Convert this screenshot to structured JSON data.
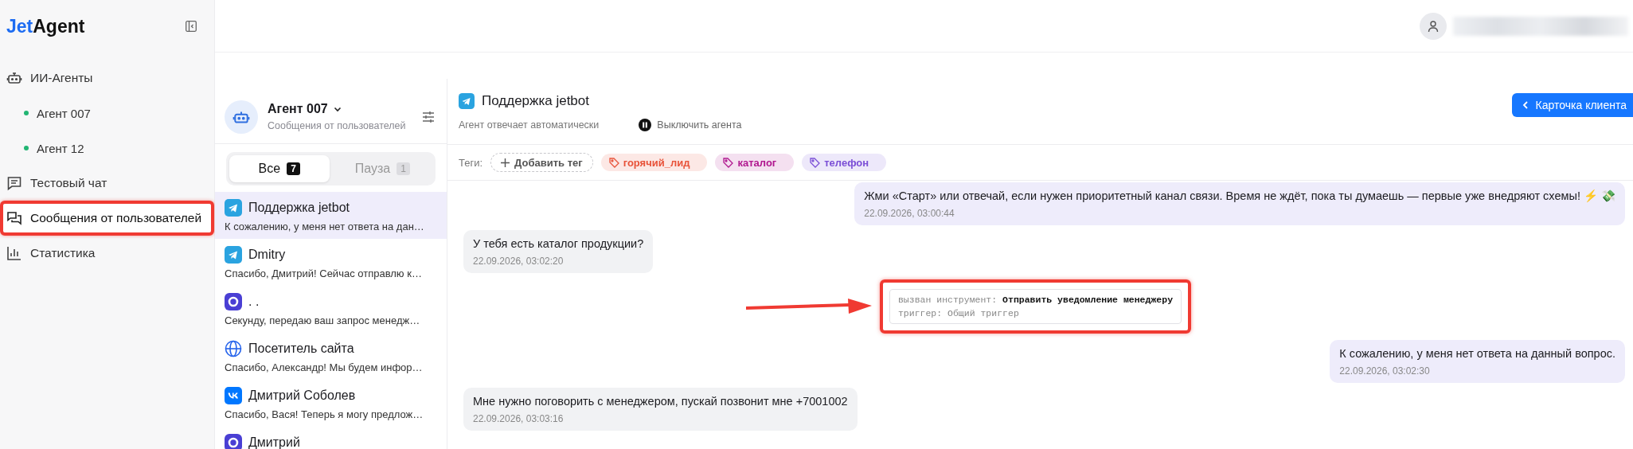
{
  "sidebar": {
    "logo": {
      "accent": "Jet",
      "rest": "Agent"
    },
    "items": [
      {
        "label": "ИИ-Агенты",
        "kind": "robot",
        "selected": false,
        "highlighted": false,
        "children": [
          {
            "label": "Агент 007",
            "color": "#22b573"
          },
          {
            "label": "Агент 12",
            "color": "#22b573"
          }
        ]
      },
      {
        "label": "Тестовый чат",
        "kind": "chat",
        "selected": false,
        "highlighted": false
      },
      {
        "label": "Сообщения от пользователей",
        "kind": "messages",
        "selected": true,
        "highlighted": true
      },
      {
        "label": "Статистика",
        "kind": "chart",
        "selected": false,
        "highlighted": false
      }
    ]
  },
  "conversation_list": {
    "agent": {
      "name": "Агент 007",
      "subtitle": "Сообщения от пользователей"
    },
    "tabs": [
      {
        "label": "Все",
        "count": "7",
        "selected": true
      },
      {
        "label": "Пауза",
        "count": "1",
        "selected": false
      }
    ],
    "items": [
      {
        "kind": "telegram",
        "name": "Поддержка jetbot",
        "preview": "К сожалению, у меня нет ответа на дан…",
        "selected": true
      },
      {
        "kind": "telegram",
        "name": "Dmitry",
        "preview": "Спасибо, Дмитрий! Сейчас отправлю к…",
        "selected": false
      },
      {
        "kind": "ring",
        "name": ". .",
        "preview": "Секунду, передаю ваш запрос менедж…",
        "selected": false
      },
      {
        "kind": "web",
        "name": "Посетитель сайта",
        "preview": "Спасибо, Александр! Мы будем инфор…",
        "selected": false
      },
      {
        "kind": "vk",
        "name": "Дмитрий Соболев",
        "preview": "Спасибо, Вася! Теперь я могу предлож…",
        "selected": false
      },
      {
        "kind": "ring",
        "name": "Дмитрий",
        "selected": false
      }
    ]
  },
  "chat": {
    "kind": "telegram",
    "title": "Поддержка jetbot",
    "status": "Агент отвечает автоматически",
    "pause_button": "Выключить агента",
    "client_card_button": "Карточка клиента",
    "tags_label": "Теги:",
    "add_tag_button": "Добавить тег",
    "tags": [
      {
        "label": "горячий_лид",
        "color": "#e8533a"
      },
      {
        "label": "каталог",
        "color": "#b0178f"
      },
      {
        "label": "телефон",
        "color": "#7b4fd6"
      }
    ],
    "messages": [
      {
        "kind": "outgoing",
        "text": "Жми «Старт» или отвечай, если нужен приоритетный канал связи. Время не ждёт, пока ты думаешь — первые уже внедряют схемы! ⚡ 💸",
        "time": "22.09.2026, 03:00:44"
      },
      {
        "kind": "incoming",
        "text": "У тебя есть каталог продукции?",
        "time": "22.09.2026, 03:02:20"
      },
      {
        "kind": "tool",
        "label": "вызван инструмент:",
        "tool": "Отправить уведомление менеджеру",
        "trigger": "триггер: Общий триггер",
        "highlighted": true
      },
      {
        "kind": "outgoing",
        "text": "К сожалению, у меня нет ответа на данный вопрос.",
        "time": "22.09.2026, 03:02:30"
      },
      {
        "kind": "incoming",
        "text": "Мне  нужно поговорить с менеджером, пускай позвонит мне +7001002",
        "time": "22.09.2026, 03:03:16"
      }
    ]
  }
}
